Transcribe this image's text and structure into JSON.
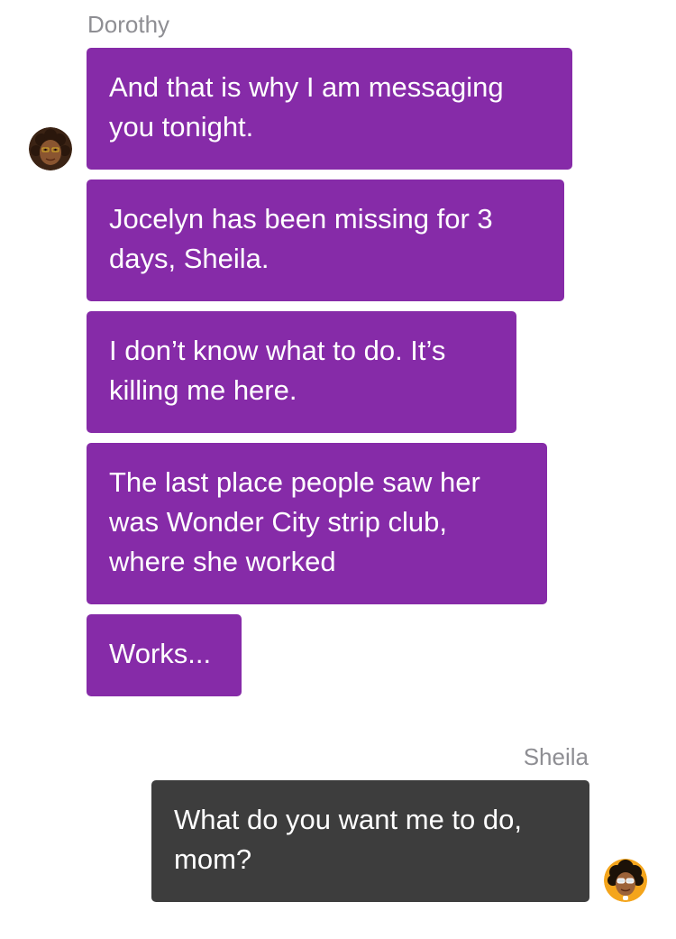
{
  "thread": {
    "incoming": {
      "sender": "Dorothy",
      "messages": [
        "And that is why I am messaging you tonight.",
        "Jocelyn has been missing for 3 days, Sheila.",
        "I don’t know what to do. It’s killing me here.",
        "The last place people saw her was Wonder City strip club, where she worked",
        "Works..."
      ]
    },
    "outgoing": {
      "sender": "Sheila",
      "messages": [
        "What do you want me to do, mom?"
      ]
    }
  },
  "colors": {
    "incoming_bubble": "#862ba8",
    "outgoing_bubble": "#3d3d3d",
    "sender_name": "#8e8e93"
  },
  "icons": {
    "incoming_avatar": "dorothy-avatar-icon",
    "outgoing_avatar": "sheila-avatar-icon"
  }
}
